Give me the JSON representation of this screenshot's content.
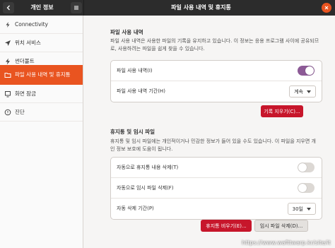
{
  "titlebar": {
    "left_title": "개인 정보",
    "title": "파일 사용 내역 및 휴지통"
  },
  "sidebar": {
    "items": [
      {
        "label": "Connectivity",
        "icon": "connectivity-icon"
      },
      {
        "label": "위치 서비스",
        "icon": "location-icon"
      },
      {
        "label": "썬더볼트",
        "icon": "thunderbolt-icon"
      },
      {
        "label": "파일 사용 내역 및 휴지통",
        "icon": "file-history-icon",
        "active": true
      },
      {
        "label": "화면 잠금",
        "icon": "screen-lock-icon"
      },
      {
        "label": "진단",
        "icon": "diagnostics-icon"
      }
    ]
  },
  "history": {
    "title": "파일 사용 내역",
    "desc_line1": "파일 사용 내역은 사용한 파일의 기록을 유지하고 있습니다. 이 정보는 응용 프로그램 사이에 공유되므",
    "desc_line2": "로, 사용하려는 파일을 쉽게 찾을 수 있습니다.",
    "row_history_label": "파일 사용 내역(I)",
    "history_toggle_on": true,
    "row_duration_label": "파일 사용 내역 기간(H)",
    "duration_value": "계속",
    "clear_button": "기록 지우기(C)..."
  },
  "trash": {
    "title": "휴지통 및 임시 파일",
    "desc_line1": "휴지통 및 임시 파일에는 개인적이거나 민감한 정보가 들어 있을 수도 있습니다. 이 파일을 지우면 개",
    "desc_line2": "인 정보 보호에 도움이 됩니다.",
    "row_auto_trash_label": "자동으로 휴지통 내용 삭제(T)",
    "auto_trash_on": false,
    "row_auto_temp_label": "자동으로 임시 파일 삭제(F)",
    "auto_temp_on": false,
    "row_period_label": "자동 삭제 기간(P)",
    "period_value": "30일",
    "empty_trash_button": "휴지통 비우기(E)...",
    "delete_temp_button": "임시 파일 삭제(D)..."
  },
  "watermark": "https://www.wafttwarp.kr/site/it",
  "colors": {
    "accent": "#e95420",
    "toggle_on": "#8c5a96",
    "destructive": "#c7162b"
  }
}
